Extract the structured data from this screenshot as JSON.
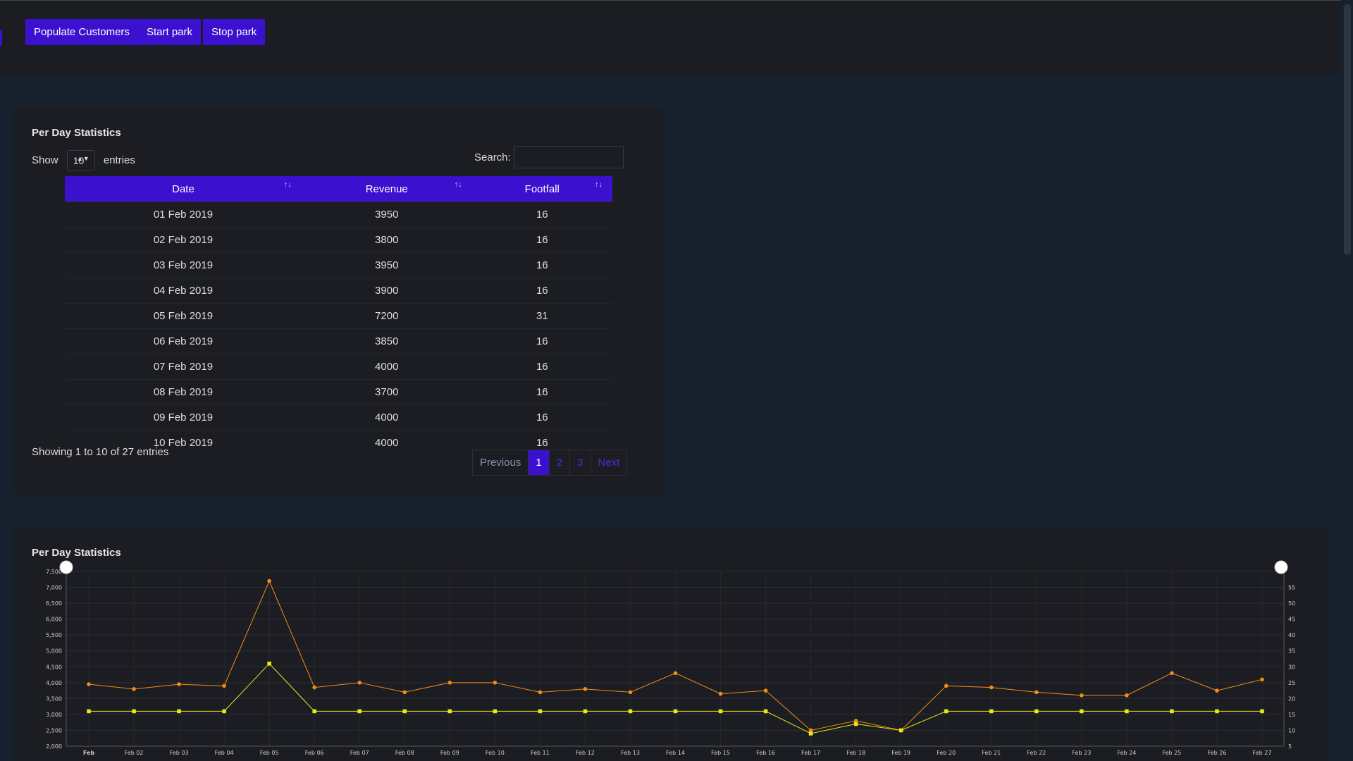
{
  "toolbar": {
    "populate_label": "Populate Customers",
    "start_label": "Start park",
    "stop_label": "Stop park"
  },
  "table_panel": {
    "title": "Per Day Statistics",
    "show_label": "Show",
    "entries_value": "10",
    "entries_label": "entries",
    "search_label": "Search:",
    "search_value": "",
    "columns": [
      "Date",
      "Revenue",
      "Footfall"
    ],
    "rows": [
      [
        "01 Feb 2019",
        "3950",
        "16"
      ],
      [
        "02 Feb 2019",
        "3800",
        "16"
      ],
      [
        "03 Feb 2019",
        "3950",
        "16"
      ],
      [
        "04 Feb 2019",
        "3900",
        "16"
      ],
      [
        "05 Feb 2019",
        "7200",
        "31"
      ],
      [
        "06 Feb 2019",
        "3850",
        "16"
      ],
      [
        "07 Feb 2019",
        "4000",
        "16"
      ],
      [
        "08 Feb 2019",
        "3700",
        "16"
      ],
      [
        "09 Feb 2019",
        "4000",
        "16"
      ],
      [
        "10 Feb 2019",
        "4000",
        "16"
      ]
    ],
    "info": "Showing 1 to 10 of 27 entries",
    "pagination": {
      "previous": "Previous",
      "pages": [
        "1",
        "2",
        "3"
      ],
      "active_page": "1",
      "next": "Next"
    }
  },
  "chart_panel": {
    "title": "Per Day Statistics"
  },
  "colors": {
    "accent": "#3b10cf",
    "revenue_line": "#f28c18",
    "footfall_line": "#e8e81a"
  },
  "chart_data": {
    "type": "line",
    "categories": [
      "Feb",
      "Feb 02",
      "Feb 03",
      "Feb 04",
      "Feb 05",
      "Feb 06",
      "Feb 07",
      "Feb 08",
      "Feb 09",
      "Feb 10",
      "Feb 11",
      "Feb 12",
      "Feb 13",
      "Feb 14",
      "Feb 15",
      "Feb 16",
      "Feb 17",
      "Feb 18",
      "Feb 19",
      "Feb 20",
      "Feb 21",
      "Feb 22",
      "Feb 23",
      "Feb 24",
      "Feb 25",
      "Feb 26",
      "Feb 27"
    ],
    "series": [
      {
        "axis": "left",
        "values": [
          3950,
          3800,
          3950,
          3900,
          7200,
          3850,
          4000,
          3700,
          4000,
          4000,
          3700,
          3800,
          3700,
          4300,
          3650,
          3750,
          2500,
          2800,
          2500,
          3900,
          3850,
          3700,
          3600,
          3600,
          4300,
          3750,
          4100
        ]
      },
      {
        "axis": "right",
        "values": [
          16,
          16,
          16,
          16,
          31,
          16,
          16,
          16,
          16,
          16,
          16,
          16,
          16,
          16,
          16,
          16,
          9,
          12,
          10,
          16,
          16,
          16,
          16,
          16,
          16,
          16,
          16
        ]
      }
    ],
    "y_left": {
      "ylim": [
        2000,
        7500
      ],
      "ticks": [
        "2,000",
        "2,500",
        "3,000",
        "3,500",
        "4,000",
        "4,500",
        "5,000",
        "5,500",
        "6,000",
        "6,500",
        "7,000",
        "7,500"
      ]
    },
    "y_right": {
      "ylim": [
        5,
        60
      ],
      "ticks": [
        "5",
        "10",
        "15",
        "20",
        "25",
        "30",
        "35",
        "40",
        "45",
        "50",
        "55"
      ]
    },
    "grid": true
  }
}
